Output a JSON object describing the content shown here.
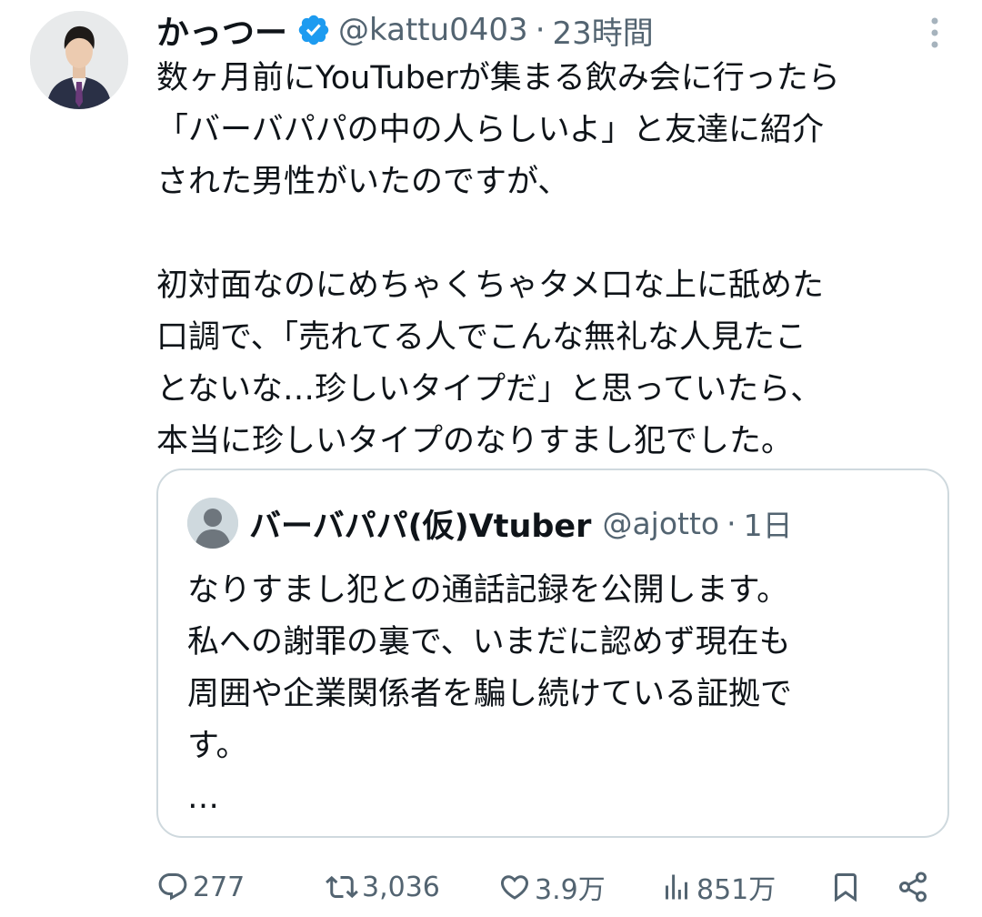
{
  "tweet": {
    "display_name": "かっつー",
    "handle": "@kattu0403",
    "separator": "·",
    "time": "23時間",
    "body": "数ヶ月前にYouTuberが集まる飲み会に行ったら\n「バーバパパの中の人らしいよ」と友達に紹介\nされた男性がいたのですが、\n\n初対面なのにめちゃくちゃタメ口な上に舐めた\n口調で、「売れてる人でこんな無礼な人見たこ\nとないな…珍しいタイプだ」と思っていたら、\n本当に珍しいタイプのなりすまし犯でした。"
  },
  "quote": {
    "display_name": "バーバパパ(仮)Vtuber",
    "handle": "@ajotto",
    "separator": "·",
    "time": "1日",
    "body": "なりすまし犯との通話記録を公開します。\n私への謝罪の裏で、いまだに認めず現在も\n周囲や企業関係者を騙し続けている証拠で\nす。\n…"
  },
  "actions": {
    "replies": "277",
    "reposts": "3,036",
    "likes": "3.9万",
    "views": "851万"
  },
  "colors": {
    "verified_blue": "#1d9bf0",
    "secondary_text": "#536471",
    "border": "#cfd9de"
  },
  "icons": {
    "reply": "reply-icon",
    "repost": "repost-icon",
    "like": "heart-icon",
    "views": "views-icon",
    "bookmark": "bookmark-icon",
    "share": "share-icon",
    "more": "more-vertical-icon",
    "verified": "verified-badge-icon"
  }
}
